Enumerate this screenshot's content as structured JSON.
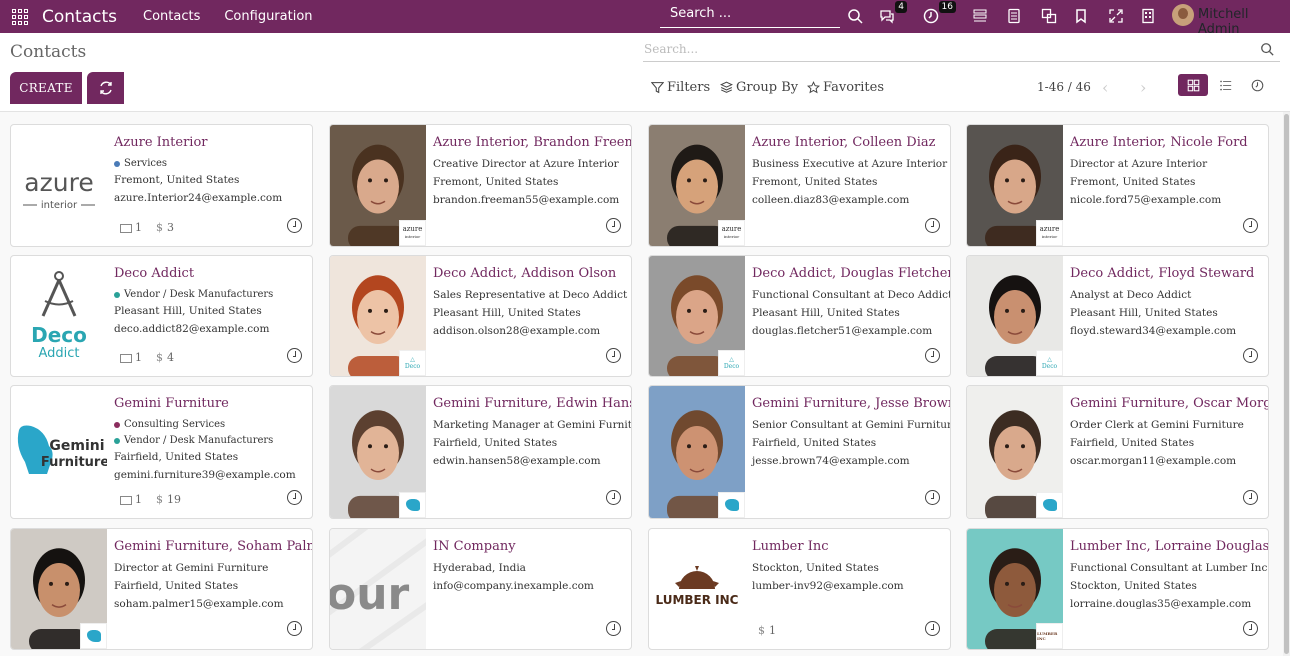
{
  "navbar": {
    "brand": "Contacts",
    "menus": [
      "Contacts",
      "Configuration"
    ],
    "search_placeholder": "Search ...",
    "messages_count": "4",
    "activities_count": "16",
    "user": "Mitchell Admin"
  },
  "control": {
    "title": "Contacts",
    "search_placeholder": "Search...",
    "create_label": "CREATE",
    "filters_label": "Filters",
    "groupby_label": "Group By",
    "favorites_label": "Favorites",
    "pager": "1-46 / 46"
  },
  "cards": [
    {
      "name": "Azure Interior",
      "tags": [
        {
          "label": "Services",
          "color": "#4a7bb7"
        }
      ],
      "lines": [
        "Fremont, United States",
        "azure.Interior24@example.com"
      ],
      "stats": {
        "meetings": "1",
        "sales": "3"
      },
      "logo": "azure",
      "photo": false
    },
    {
      "name": "Azure Interior, Brandon Freeman",
      "lines": [
        "Creative Director at Azure Interior",
        "Fremont, United States",
        "brandon.freeman55@example.com"
      ],
      "photo": true,
      "skin": "#d9a98c",
      "hair": "#4a3220",
      "bg": "#6b5a4a",
      "mini": "azure"
    },
    {
      "name": "Azure Interior, Colleen Diaz",
      "lines": [
        "Business Executive at Azure Interior",
        "Fremont, United States",
        "colleen.diaz83@example.com"
      ],
      "photo": true,
      "skin": "#d6a27a",
      "hair": "#1f1a16",
      "bg": "#8b7e71",
      "mini": "azure"
    },
    {
      "name": "Azure Interior, Nicole Ford",
      "lines": [
        "Director at Azure Interior",
        "Fremont, United States",
        "nicole.ford75@example.com"
      ],
      "photo": true,
      "skin": "#d8a789",
      "hair": "#3a2418",
      "bg": "#585450",
      "mini": "azure"
    },
    {
      "name": "Deco Addict",
      "tags": [
        {
          "label": "Vendor / Desk Manufacturers",
          "color": "#2aa198"
        }
      ],
      "lines": [
        "Pleasant Hill, United States",
        "deco.addict82@example.com"
      ],
      "stats": {
        "meetings": "1",
        "sales": "4"
      },
      "logo": "deco",
      "photo": false
    },
    {
      "name": "Deco Addict, Addison Olson",
      "lines": [
        "Sales Representative at Deco Addict",
        "Pleasant Hill, United States",
        "addison.olson28@example.com"
      ],
      "photo": true,
      "skin": "#edc3a6",
      "hair": "#b3461f",
      "bg": "#efe5dc",
      "mini": "deco"
    },
    {
      "name": "Deco Addict, Douglas Fletcher",
      "lines": [
        "Functional Consultant at Deco Addict",
        "Pleasant Hill, United States",
        "douglas.fletcher51@example.com"
      ],
      "photo": true,
      "skin": "#dba588",
      "hair": "#7a4a2a",
      "bg": "#9c9c9c",
      "mini": "deco"
    },
    {
      "name": "Deco Addict, Floyd Steward",
      "lines": [
        "Analyst at Deco Addict",
        "Pleasant Hill, United States",
        "floyd.steward34@example.com"
      ],
      "photo": true,
      "skin": "#c99070",
      "hair": "#161211",
      "bg": "#e8e8e6",
      "mini": "deco"
    },
    {
      "name": "Gemini Furniture",
      "tags": [
        {
          "label": "Consulting Services",
          "color": "#8b2d5e"
        },
        {
          "label": "Vendor / Desk Manufacturers",
          "color": "#2aa198"
        }
      ],
      "lines": [
        "Fairfield, United States",
        "gemini.furniture39@example.com"
      ],
      "stats": {
        "meetings": "1",
        "sales": "19"
      },
      "logo": "gemini",
      "photo": false
    },
    {
      "name": "Gemini Furniture, Edwin Hansen",
      "lines": [
        "Marketing Manager at Gemini Furniture",
        "Fairfield, United States",
        "edwin.hansen58@example.com"
      ],
      "photo": true,
      "skin": "#e1b497",
      "hair": "#5c4030",
      "bg": "#d9d9d9",
      "mini": "gemini"
    },
    {
      "name": "Gemini Furniture, Jesse Brown",
      "lines": [
        "Senior Consultant at Gemini Furniture",
        "Fairfield, United States",
        "jesse.brown74@example.com"
      ],
      "photo": true,
      "skin": "#cd9272",
      "hair": "#70492f",
      "bg": "#7ea0c6",
      "mini": "gemini"
    },
    {
      "name": "Gemini Furniture, Oscar Morgan",
      "lines": [
        "Order Clerk at Gemini Furniture",
        "Fairfield, United States",
        "oscar.morgan11@example.com"
      ],
      "photo": true,
      "skin": "#d9a98c",
      "hair": "#3c2c22",
      "bg": "#efefed",
      "mini": "gemini"
    },
    {
      "name": "Gemini Furniture, Soham Palmer",
      "lines": [
        "Director at Gemini Furniture",
        "Fairfield, United States",
        "soham.palmer15@example.com"
      ],
      "photo": true,
      "skin": "#c8906c",
      "hair": "#151210",
      "bg": "#cfcac4",
      "mini": "gemini"
    },
    {
      "name": "IN Company",
      "lines": [
        "Hyderabad, India",
        "info@company.inexample.com"
      ],
      "photo": false,
      "logo": "in"
    },
    {
      "name": "Lumber Inc",
      "lines": [
        "Stockton, United States",
        "lumber-inv92@example.com"
      ],
      "stats": {
        "sales": "1"
      },
      "logo": "lumber",
      "photo": false
    },
    {
      "name": "Lumber Inc, Lorraine Douglas",
      "lines": [
        "Functional Consultant at Lumber Inc",
        "Stockton, United States",
        "lorraine.douglas35@example.com"
      ],
      "photo": true,
      "skin": "#8e5a3c",
      "hair": "#2a1d16",
      "bg": "#76c9c4",
      "mini": "lumber"
    }
  ],
  "logos": {
    "azure": {
      "word": "azure",
      "sub": "interior"
    },
    "deco": {
      "word": "Deco",
      "sub": "Addict"
    },
    "gemini": {
      "word": "Gemini",
      "sub": "Furniture"
    },
    "in": {
      "word": "our"
    },
    "lumber": {
      "word": "LUMBER INC"
    }
  }
}
